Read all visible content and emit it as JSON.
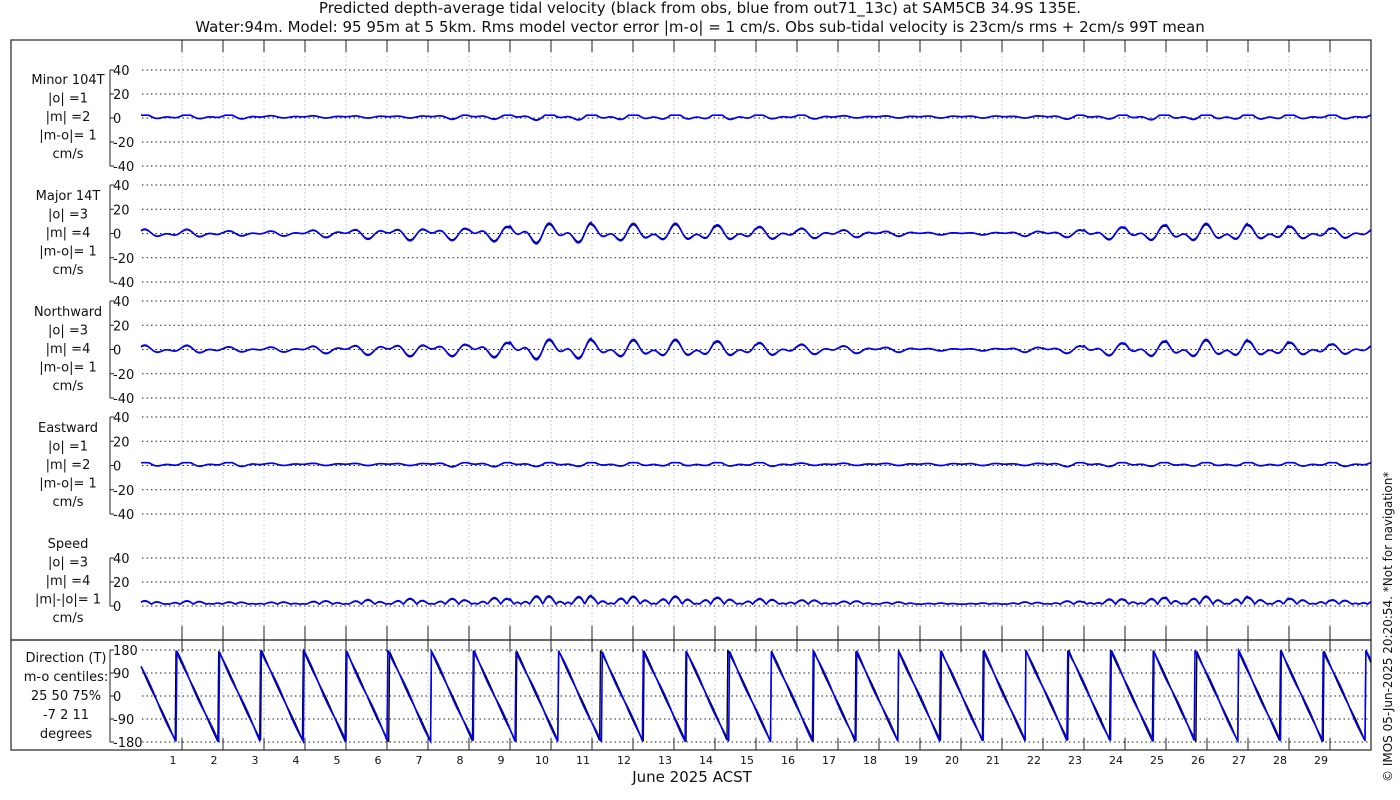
{
  "title_line1": "Predicted depth-average tidal velocity (black from obs, blue from out71_13c) at SAM5CB 34.9S 135E.",
  "title_line2": "Water:94m. Model: 95 95m at 5 5km. Rms model vector error |m-o| = 1 cm/s. Obs sub-tidal velocity is 23cm/s rms + 2cm/s 99T mean",
  "xlabel": "June 2025 ACST",
  "credit": "© IMOS 05-Jun-2025 20:20:54. *Not for navigation*",
  "colors": {
    "obs": "#000000",
    "model": "#0000ff",
    "grid": "#b8c4e8"
  },
  "chart_data": [
    {
      "type": "line",
      "name_lines": [
        "Minor 104T",
        "|o| =1",
        "|m| =2",
        "|m-o|= 1",
        "cm/s"
      ],
      "ylim": [
        -40,
        40
      ],
      "yticks": [
        "40",
        "20",
        "0",
        "-20",
        "-40"
      ],
      "daily_amplitude_cm_s": [
        2,
        2,
        2,
        1,
        1,
        1,
        1,
        2,
        2,
        3,
        3,
        3,
        3,
        3,
        3,
        2,
        2,
        1,
        1,
        1,
        1,
        1,
        2,
        2,
        3,
        3,
        3,
        3,
        2,
        2
      ]
    },
    {
      "type": "line",
      "name_lines": [
        "Major 14T",
        "|o| =3",
        "|m| =4",
        "|m-o|= 1",
        "cm/s"
      ],
      "ylim": [
        -40,
        40
      ],
      "yticks": [
        "40",
        "20",
        "0",
        "-20",
        "-40"
      ],
      "daily_amplitude_cm_s": [
        3,
        3,
        2,
        2,
        3,
        4,
        5,
        5,
        6,
        8,
        8,
        7,
        7,
        7,
        6,
        5,
        4,
        3,
        2,
        1,
        1,
        2,
        3,
        5,
        6,
        7,
        7,
        6,
        5,
        4
      ]
    },
    {
      "type": "line",
      "name_lines": [
        "Northward",
        "|o| =3",
        "|m| =4",
        "|m-o|= 1",
        "cm/s"
      ],
      "ylim": [
        -40,
        40
      ],
      "yticks": [
        "40",
        "20",
        "0",
        "-20",
        "-40"
      ],
      "daily_amplitude_cm_s": [
        3,
        3,
        2,
        2,
        3,
        4,
        5,
        5,
        6,
        8,
        8,
        7,
        7,
        7,
        6,
        5,
        4,
        3,
        2,
        1,
        1,
        2,
        3,
        5,
        6,
        7,
        7,
        6,
        5,
        4
      ]
    },
    {
      "type": "line",
      "name_lines": [
        "Eastward",
        "|o| =1",
        "|m| =2",
        "|m-o|= 1",
        "cm/s"
      ],
      "ylim": [
        -40,
        40
      ],
      "yticks": [
        "40",
        "20",
        "0",
        "-20",
        "-40"
      ],
      "daily_amplitude_cm_s": [
        2,
        2,
        2,
        1,
        1,
        1,
        1,
        2,
        2,
        2,
        2,
        2,
        2,
        2,
        2,
        2,
        1,
        1,
        1,
        1,
        1,
        1,
        2,
        2,
        2,
        2,
        2,
        2,
        2,
        2
      ]
    },
    {
      "type": "line",
      "name_lines": [
        "Speed",
        "|o| =3",
        "|m| =4",
        "|m|-|o|= 1",
        "cm/s"
      ],
      "ylim": [
        0,
        40
      ],
      "yticks": [
        "40",
        "20",
        "0"
      ],
      "daily_amplitude_cm_s": [
        3,
        3,
        2,
        2,
        3,
        4,
        5,
        5,
        6,
        8,
        8,
        7,
        7,
        7,
        6,
        5,
        4,
        3,
        2,
        1,
        1,
        2,
        3,
        5,
        6,
        7,
        7,
        6,
        5,
        4
      ]
    },
    {
      "type": "line",
      "name_lines": [
        "Direction (T)",
        "m-o centiles:",
        "25  50  75%",
        "-7    2  11",
        "degrees"
      ],
      "ylim": [
        -180,
        180
      ],
      "yticks": [
        "180",
        "90",
        "0",
        "-90",
        "-180"
      ],
      "centiles": {
        "25": -7,
        "50": 2,
        "75": 11
      }
    }
  ],
  "days": [
    "1",
    "2",
    "3",
    "4",
    "5",
    "6",
    "7",
    "8",
    "9",
    "10",
    "11",
    "12",
    "13",
    "14",
    "15",
    "16",
    "17",
    "18",
    "19",
    "20",
    "21",
    "22",
    "23",
    "24",
    "25",
    "26",
    "27",
    "28",
    "29"
  ]
}
